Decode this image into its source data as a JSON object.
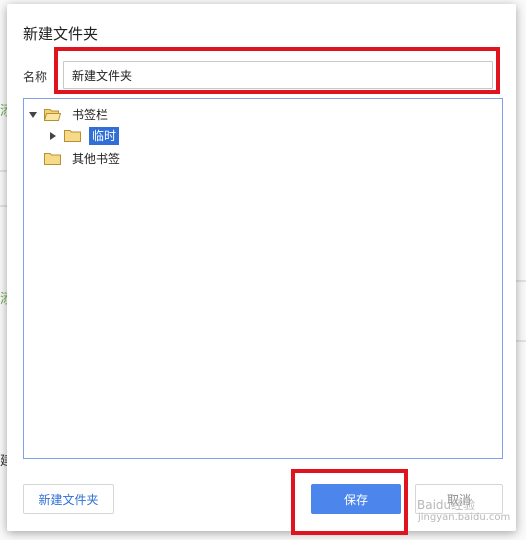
{
  "dialog": {
    "title": "新建文件夹",
    "name_label": "名称",
    "name_value": "新建文件夹"
  },
  "tree": {
    "items": [
      {
        "label": "书签栏",
        "expanded": true,
        "icon": "folder-open-icon"
      },
      {
        "label": "临时",
        "expanded": false,
        "selected": true,
        "icon": "folder-icon"
      },
      {
        "label": "其他书签",
        "icon": "folder-icon"
      }
    ]
  },
  "buttons": {
    "new_folder": "新建文件夹",
    "save": "保存",
    "cancel": "取消"
  },
  "watermark": {
    "brand": "Baidu经验",
    "url": "jingyan.baidu.com"
  },
  "background": {
    "fragment_1": "添",
    "fragment_2": "添",
    "fragment_3": "建"
  },
  "colors": {
    "highlight_red": "#e0141e",
    "accent_blue": "#4c86ec",
    "selection_blue": "#2f6fd6",
    "tree_border": "#7ea1e8"
  }
}
